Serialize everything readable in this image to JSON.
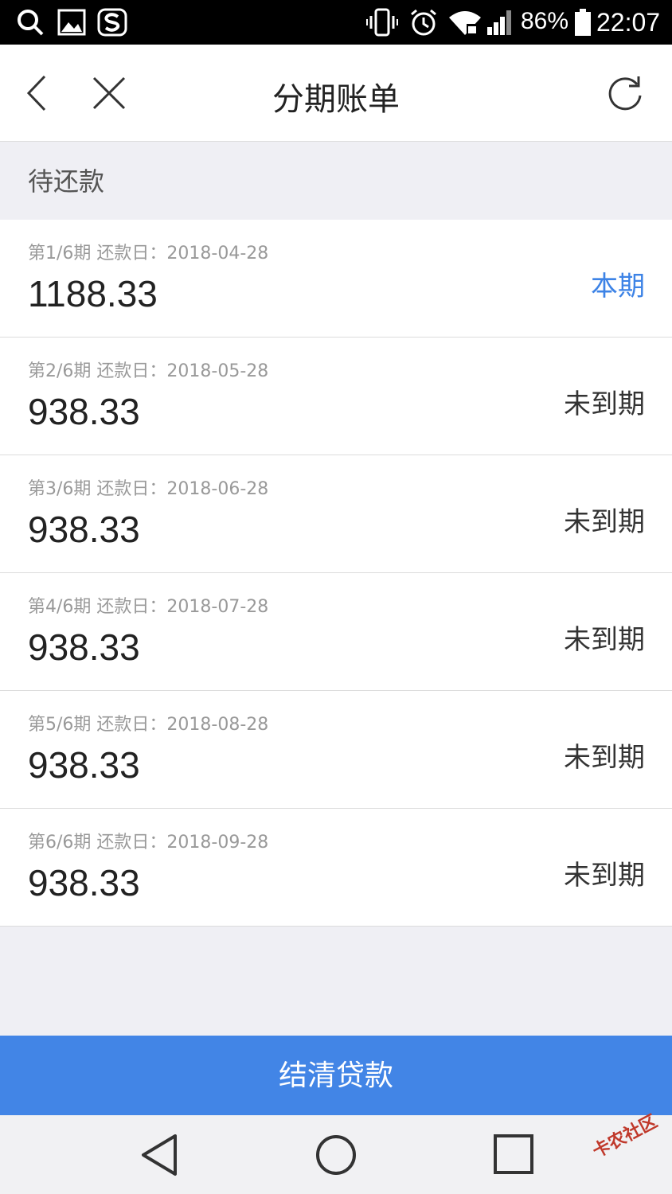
{
  "status_bar": {
    "battery": "86%",
    "time": "22:07",
    "icons": [
      "search-icon",
      "image-icon",
      "sogou-icon",
      "vibrate-icon",
      "alarm-icon",
      "wifi-icon",
      "signal-icon",
      "battery-icon"
    ]
  },
  "header": {
    "title": "分期账单",
    "back_icon": "chevron-left-icon",
    "close_icon": "close-icon",
    "refresh_icon": "refresh-icon"
  },
  "section": {
    "label": "待还款"
  },
  "installments": [
    {
      "meta": "第1/6期 还款日：2018-04-28",
      "amount": "1188.33",
      "status": "本期",
      "current": true
    },
    {
      "meta": "第2/6期 还款日：2018-05-28",
      "amount": "938.33",
      "status": "未到期",
      "current": false
    },
    {
      "meta": "第3/6期 还款日：2018-06-28",
      "amount": "938.33",
      "status": "未到期",
      "current": false
    },
    {
      "meta": "第4/6期 还款日：2018-07-28",
      "amount": "938.33",
      "status": "未到期",
      "current": false
    },
    {
      "meta": "第5/6期 还款日：2018-08-28",
      "amount": "938.33",
      "status": "未到期",
      "current": false
    },
    {
      "meta": "第6/6期 还款日：2018-09-28",
      "amount": "938.33",
      "status": "未到期",
      "current": false
    }
  ],
  "actions": {
    "settle_label": "结清贷款"
  },
  "nav": {
    "icons": [
      "back-triangle-icon",
      "home-circle-icon",
      "recents-square-icon"
    ]
  },
  "watermark": "卡农社区",
  "colors": {
    "accent": "#4285e6",
    "current_status": "#3d83e6",
    "background": "#efeff4"
  }
}
